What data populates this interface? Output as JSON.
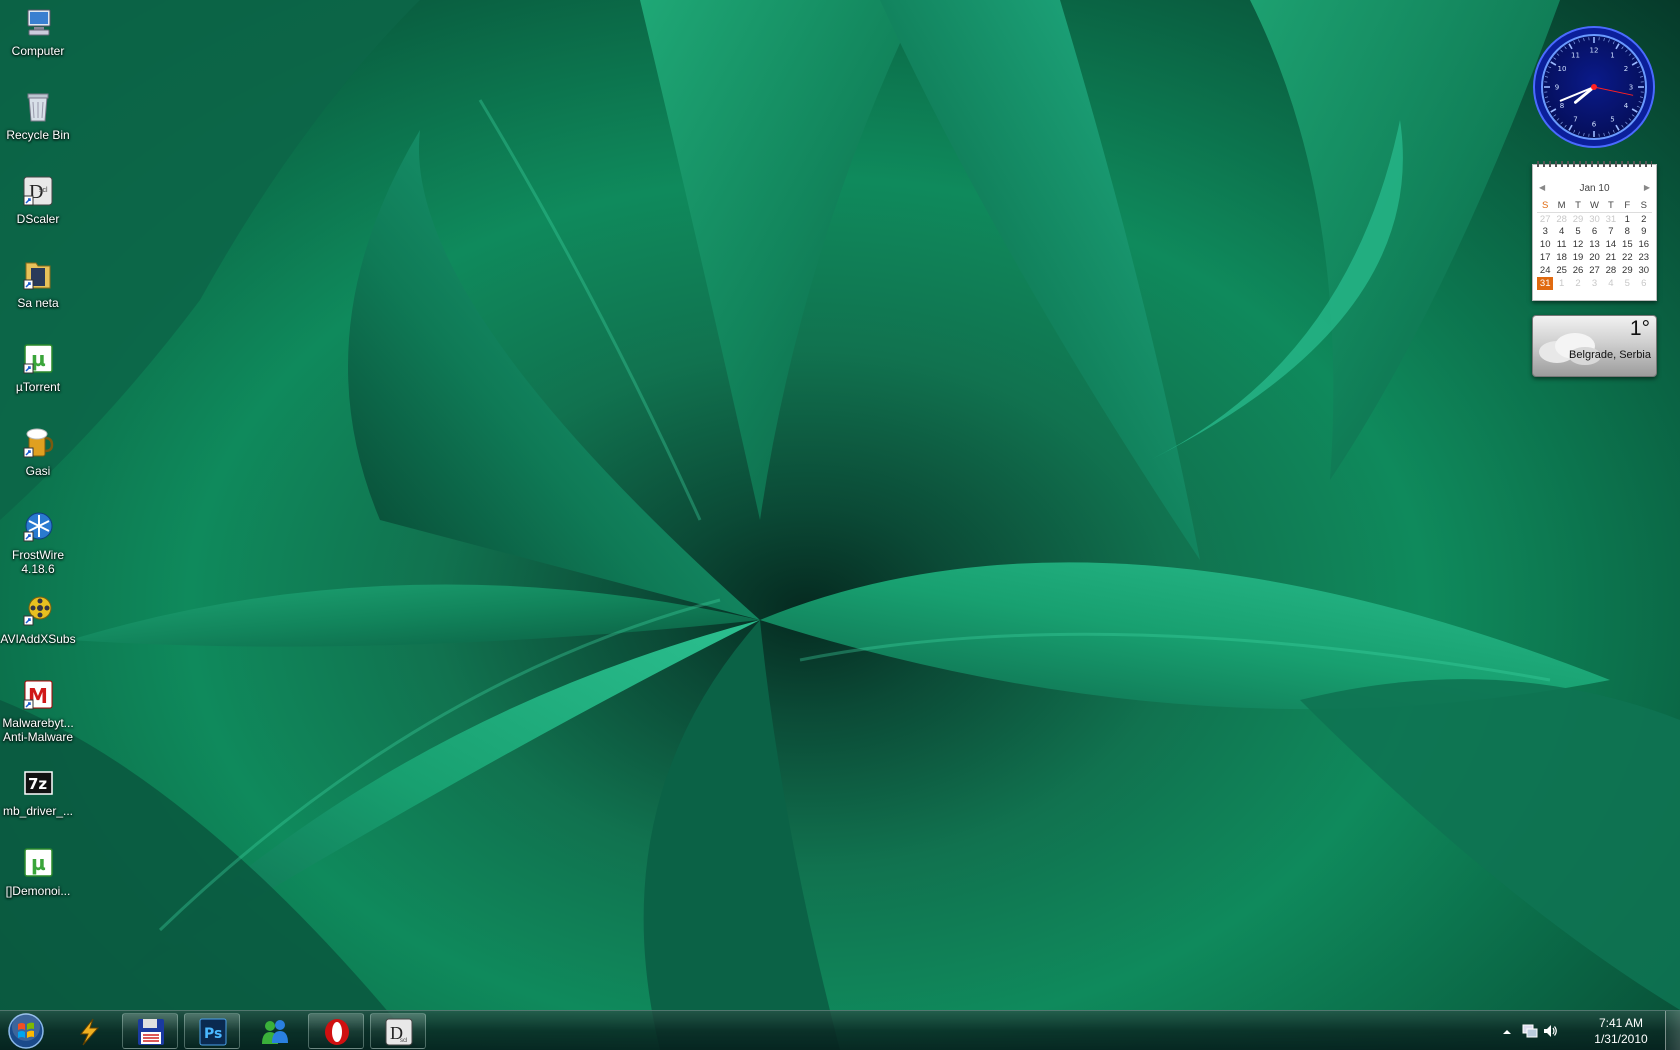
{
  "desktop": {
    "icons": [
      {
        "label": "Computer",
        "icon": "computer-icon"
      },
      {
        "label": "Recycle Bin",
        "icon": "recycle-bin-icon"
      },
      {
        "label": "DScaler",
        "icon": "dscaler-icon"
      },
      {
        "label": "Sa neta",
        "icon": "folder-icon"
      },
      {
        "label": "µTorrent",
        "icon": "utorrent-icon"
      },
      {
        "label": "Gasi",
        "icon": "beer-mug-icon"
      },
      {
        "label": "FrostWire\n4.18.6",
        "icon": "frostwire-icon"
      },
      {
        "label": "AVIAddXSubs",
        "icon": "film-reel-icon"
      },
      {
        "label": "Malwarebyt...\nAnti-Malware",
        "icon": "malwarebytes-icon"
      },
      {
        "label": "mb_driver_...",
        "icon": "7zip-archive-icon"
      },
      {
        "label": "[]Demonoi...",
        "icon": "utorrent-file-icon"
      }
    ]
  },
  "gadgets": {
    "clock": {
      "hour": 7,
      "minute": 41,
      "second": 17
    },
    "calendar": {
      "month_label": "Jan 10",
      "weekdays": [
        "S",
        "M",
        "T",
        "W",
        "T",
        "F",
        "S"
      ],
      "weeks": [
        [
          "27",
          "28",
          "29",
          "30",
          "31",
          "1",
          "2"
        ],
        [
          "3",
          "4",
          "5",
          "6",
          "7",
          "8",
          "9"
        ],
        [
          "10",
          "11",
          "12",
          "13",
          "14",
          "15",
          "16"
        ],
        [
          "17",
          "18",
          "19",
          "20",
          "21",
          "22",
          "23"
        ],
        [
          "24",
          "25",
          "26",
          "27",
          "28",
          "29",
          "30"
        ],
        [
          "31",
          "1",
          "2",
          "3",
          "4",
          "5",
          "6"
        ]
      ],
      "today": "31"
    },
    "weather": {
      "temperature": "1°",
      "location": "Belgrade, Serbia"
    }
  },
  "taskbar": {
    "pinned": [
      {
        "name": "winamp",
        "icon": "winamp-bolt-icon"
      },
      {
        "name": "save-app",
        "icon": "floppy-disk-icon"
      },
      {
        "name": "photoshop",
        "icon": "photoshop-icon",
        "text": "Ps"
      },
      {
        "name": "messenger",
        "icon": "messenger-icon"
      },
      {
        "name": "opera",
        "icon": "opera-icon"
      },
      {
        "name": "dscaler",
        "icon": "dscaler-icon"
      }
    ],
    "tray": {
      "time": "7:41 AM",
      "date": "1/31/2010"
    }
  },
  "colors": {
    "accent_orange": "#e06a10",
    "clock_blue": "#1a3cff"
  }
}
